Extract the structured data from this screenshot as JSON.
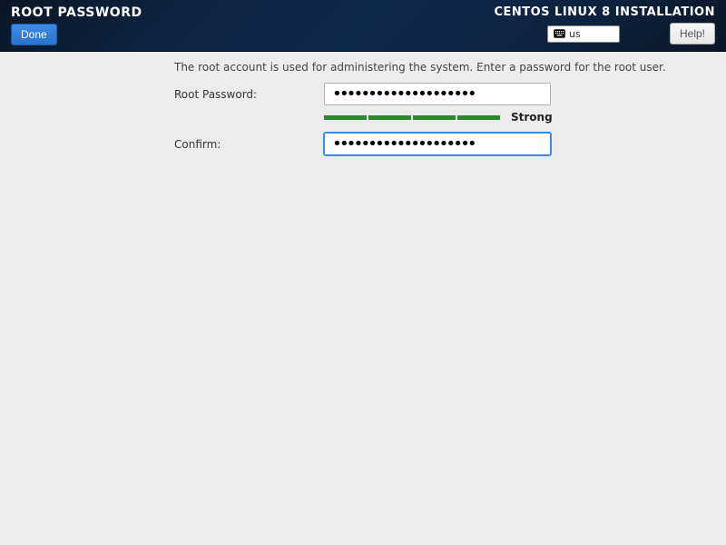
{
  "header": {
    "page_title": "ROOT PASSWORD",
    "done_label": "Done",
    "install_title": "CENTOS LINUX 8 INSTALLATION",
    "keyboard_layout": "us",
    "help_label": "Help!"
  },
  "content": {
    "description": "The root account is used for administering the system.  Enter a password for the root user.",
    "root_password_label": "Root Password:",
    "confirm_label": "Confirm:",
    "root_password_value": "••••••••••••••••••••",
    "confirm_value": "••••••••••••••••••••",
    "strength_label": "Strong",
    "strength_level": 4,
    "strength_color": "#2a8a2a"
  }
}
